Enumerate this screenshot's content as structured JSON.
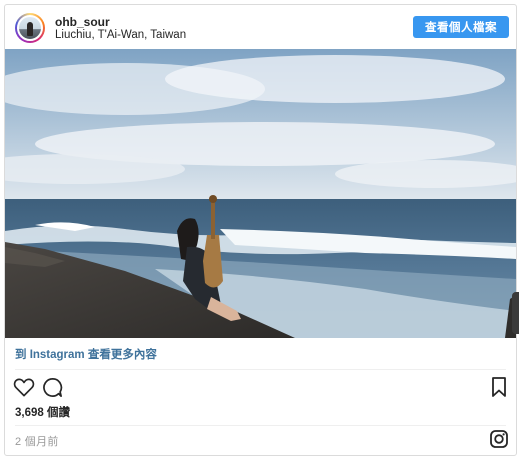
{
  "post": {
    "username": "ohb_sour",
    "location": "Liuchiu, T'Ai-Wan, Taiwan",
    "profile_button": "查看個人檔案",
    "more_link": "到 Instagram 查看更多內容",
    "likes": "3,698 個讚",
    "timestamp": "2 個月前"
  },
  "icons": {
    "like": "heart-outline-icon",
    "comment": "speech-bubble-icon",
    "save": "bookmark-icon",
    "instagram": "instagram-glyph-icon"
  },
  "colors": {
    "accent": "#3897f0",
    "link": "#3f729b",
    "muted": "#999999",
    "text": "#262626",
    "border": "#dbdbdb"
  }
}
